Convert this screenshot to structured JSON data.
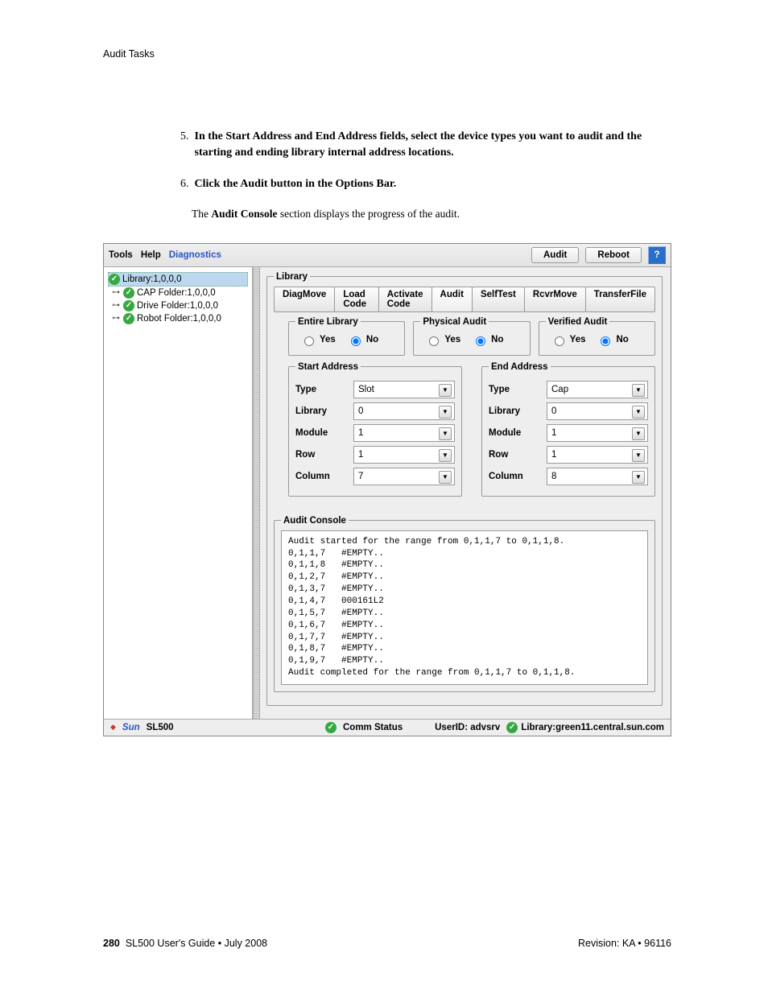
{
  "page_header": "Audit Tasks",
  "instructions": {
    "step5_num": "5.",
    "step5_text_prefix": "In the Start Address and End Address fields, select the device types you want to audit and the starting and ending library internal address locations.",
    "step6_num": "6.",
    "step6_text": "Click the Audit button in the Options Bar."
  },
  "narrative_prefix": "The ",
  "narrative_bold": "Audit Console",
  "narrative_suffix": " section displays the progress of the audit.",
  "topbar": {
    "menus": {
      "tools": "Tools",
      "help": "Help",
      "diagnostics": "Diagnostics"
    },
    "buttons": {
      "audit": "Audit",
      "reboot": "Reboot"
    },
    "help_glyph": "?"
  },
  "tree": {
    "root": "Library:1,0,0,0",
    "n1": "CAP Folder:1,0,0,0",
    "n2": "Drive Folder:1,0,0,0",
    "n3": "Robot Folder:1,0,0,0"
  },
  "library_panel_legend": "Library",
  "tabs": {
    "t1": "DiagMove",
    "t2": "Load Code",
    "t3": "Activate Code",
    "t4": "Audit",
    "t5": "SelfTest",
    "t6": "RcvrMove",
    "t7": "TransferFile"
  },
  "radio_groups": {
    "entire": {
      "legend": "Entire Library",
      "yes": "Yes",
      "no": "No"
    },
    "physical": {
      "legend": "Physical Audit",
      "yes": "Yes",
      "no": "No"
    },
    "verified": {
      "legend": "Verified Audit",
      "yes": "Yes",
      "no": "No"
    }
  },
  "start": {
    "legend": "Start Address",
    "type_label": "Type",
    "type_value": "Slot",
    "library_label": "Library",
    "library_value": "0",
    "module_label": "Module",
    "module_value": "1",
    "row_label": "Row",
    "row_value": "1",
    "column_label": "Column",
    "column_value": "7"
  },
  "end": {
    "legend": "End Address",
    "type_label": "Type",
    "type_value": "Cap",
    "library_label": "Library",
    "library_value": "0",
    "module_label": "Module",
    "module_value": "1",
    "row_label": "Row",
    "row_value": "1",
    "column_label": "Column",
    "column_value": "8"
  },
  "audit_console": {
    "legend": "Audit Console",
    "text": "Audit started for the range from 0,1,1,7 to 0,1,1,8.\n0,1,1,7   #EMPTY..\n0,1,1,8   #EMPTY..\n0,1,2,7   #EMPTY..\n0,1,3,7   #EMPTY..\n0,1,4,7   000161L2\n0,1,5,7   #EMPTY..\n0,1,6,7   #EMPTY..\n0,1,7,7   #EMPTY..\n0,1,8,7   #EMPTY..\n0,1,9,7   #EMPTY..\nAudit completed for the range from 0,1,1,7 to 0,1,1,8."
  },
  "status": {
    "sun": "Sun",
    "model": "SL500",
    "comm": "Comm Status",
    "user": "UserID: advsrv",
    "library": "Library:green11.central.sun.com"
  },
  "footer": {
    "page": "280",
    "center": "SL500 User's Guide  •  July 2008",
    "right": "Revision: KA  •  96116"
  }
}
